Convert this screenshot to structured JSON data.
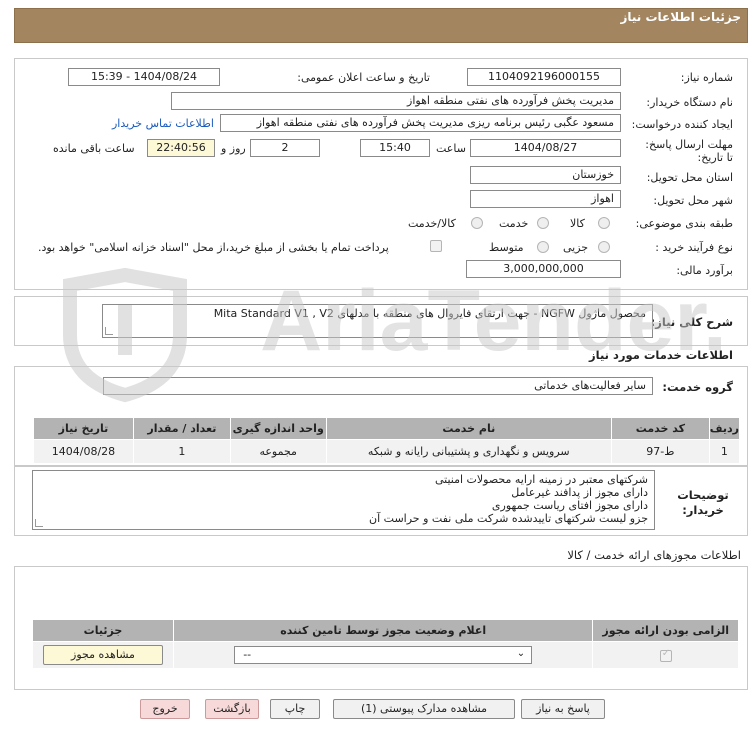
{
  "header": {
    "title": "جزئیات اطلاعات نیاز"
  },
  "info": {
    "need_number_label": "شماره نیاز:",
    "need_number": "1104092196000155",
    "announce_label": "تاریخ و ساعت اعلان عمومی:",
    "announce_value": "1404/08/24 - 15:39",
    "buyer_label": "نام دستگاه خریدار:",
    "buyer_value": "مدیریت پخش فرآورده های نفتی منطقه اهواز",
    "creator_label": "ایجاد کننده درخواست:",
    "creator_value": "مسعود عگبی رئیس برنامه ریزی مدیریت پخش فرآورده های نفتی منطقه اهواز",
    "contact_link": "اطلاعات تماس خریدار",
    "deadline_label": "مهلت ارسال پاسخ: تا تاریخ:",
    "deadline_date": "1404/08/27",
    "time_label": "ساعت",
    "deadline_time": "15:40",
    "days_value": "2",
    "days_label": "روز و",
    "remaining_value": "22:40:56",
    "remaining_label": "ساعت باقی مانده",
    "province_label": "استان محل تحویل:",
    "province_value": "خوزستان",
    "city_label": "شهر محل تحویل:",
    "city_value": "اهواز",
    "category_label": "طبقه بندی موضوعی:",
    "category_options": [
      "کالا",
      "خدمت",
      "کالا/خدمت"
    ],
    "process_label": "نوع فرآیند خرید :",
    "process_options": [
      "جزیی",
      "متوسط"
    ],
    "payment_note": "پرداخت تمام یا بخشی از مبلغ خرید،از محل \"اسناد خزانه اسلامی\" خواهد بود.",
    "budget_label": "برآورد مالی:",
    "budget_value": "3,000,000,000"
  },
  "summary": {
    "label": "شرح کلی نیاز:",
    "value": "محصول ماژول NGFW - جهت ارتقای فایروال های منطقه با مدلهای Mita Standard V1 , V2"
  },
  "services": {
    "title": "اطلاعات خدمات مورد نیاز",
    "group_label": "گروه خدمت:",
    "group_value": "سایر فعالیت‌های خدماتی",
    "columns": [
      "ردیف",
      "کد خدمت",
      "نام خدمت",
      "واحد اندازه گیری",
      "تعداد / مقدار",
      "تاریخ نیاز"
    ],
    "rows": [
      [
        "1",
        "ط-97",
        "سرویس و نگهداری و پشتیبانی رایانه و شبکه",
        "مجموعه",
        "1",
        "1404/08/28"
      ]
    ]
  },
  "notes": {
    "label": "توضیحات خریدار:",
    "lines": [
      "شرکتهای معتبر در زمینه ارایه محصولات امنیتی",
      "دارای مجوز از پدافند غیرعامل",
      "دارای مجوز افتای ریاست جمهوری",
      "جزو لیست شرکتهای تاییدشده شرکت ملی نفت و حراست آن"
    ]
  },
  "permits": {
    "title": "اطلاعات مجوزهای ارائه خدمت / کالا",
    "columns": [
      "الزامی بودن ارائه مجوز",
      "اعلام وضعیت مجوز توسط تامین کننده",
      "جزئیات"
    ],
    "select_value": "--",
    "view_button": "مشاهده مجوز"
  },
  "buttons": {
    "reply": "پاسخ به نیاز",
    "docs": "مشاهده مدارک پیوستی (1)",
    "print": "چاپ",
    "back": "بازگشت",
    "exit": "خروج"
  },
  "watermark": "AriaTender.neT"
}
